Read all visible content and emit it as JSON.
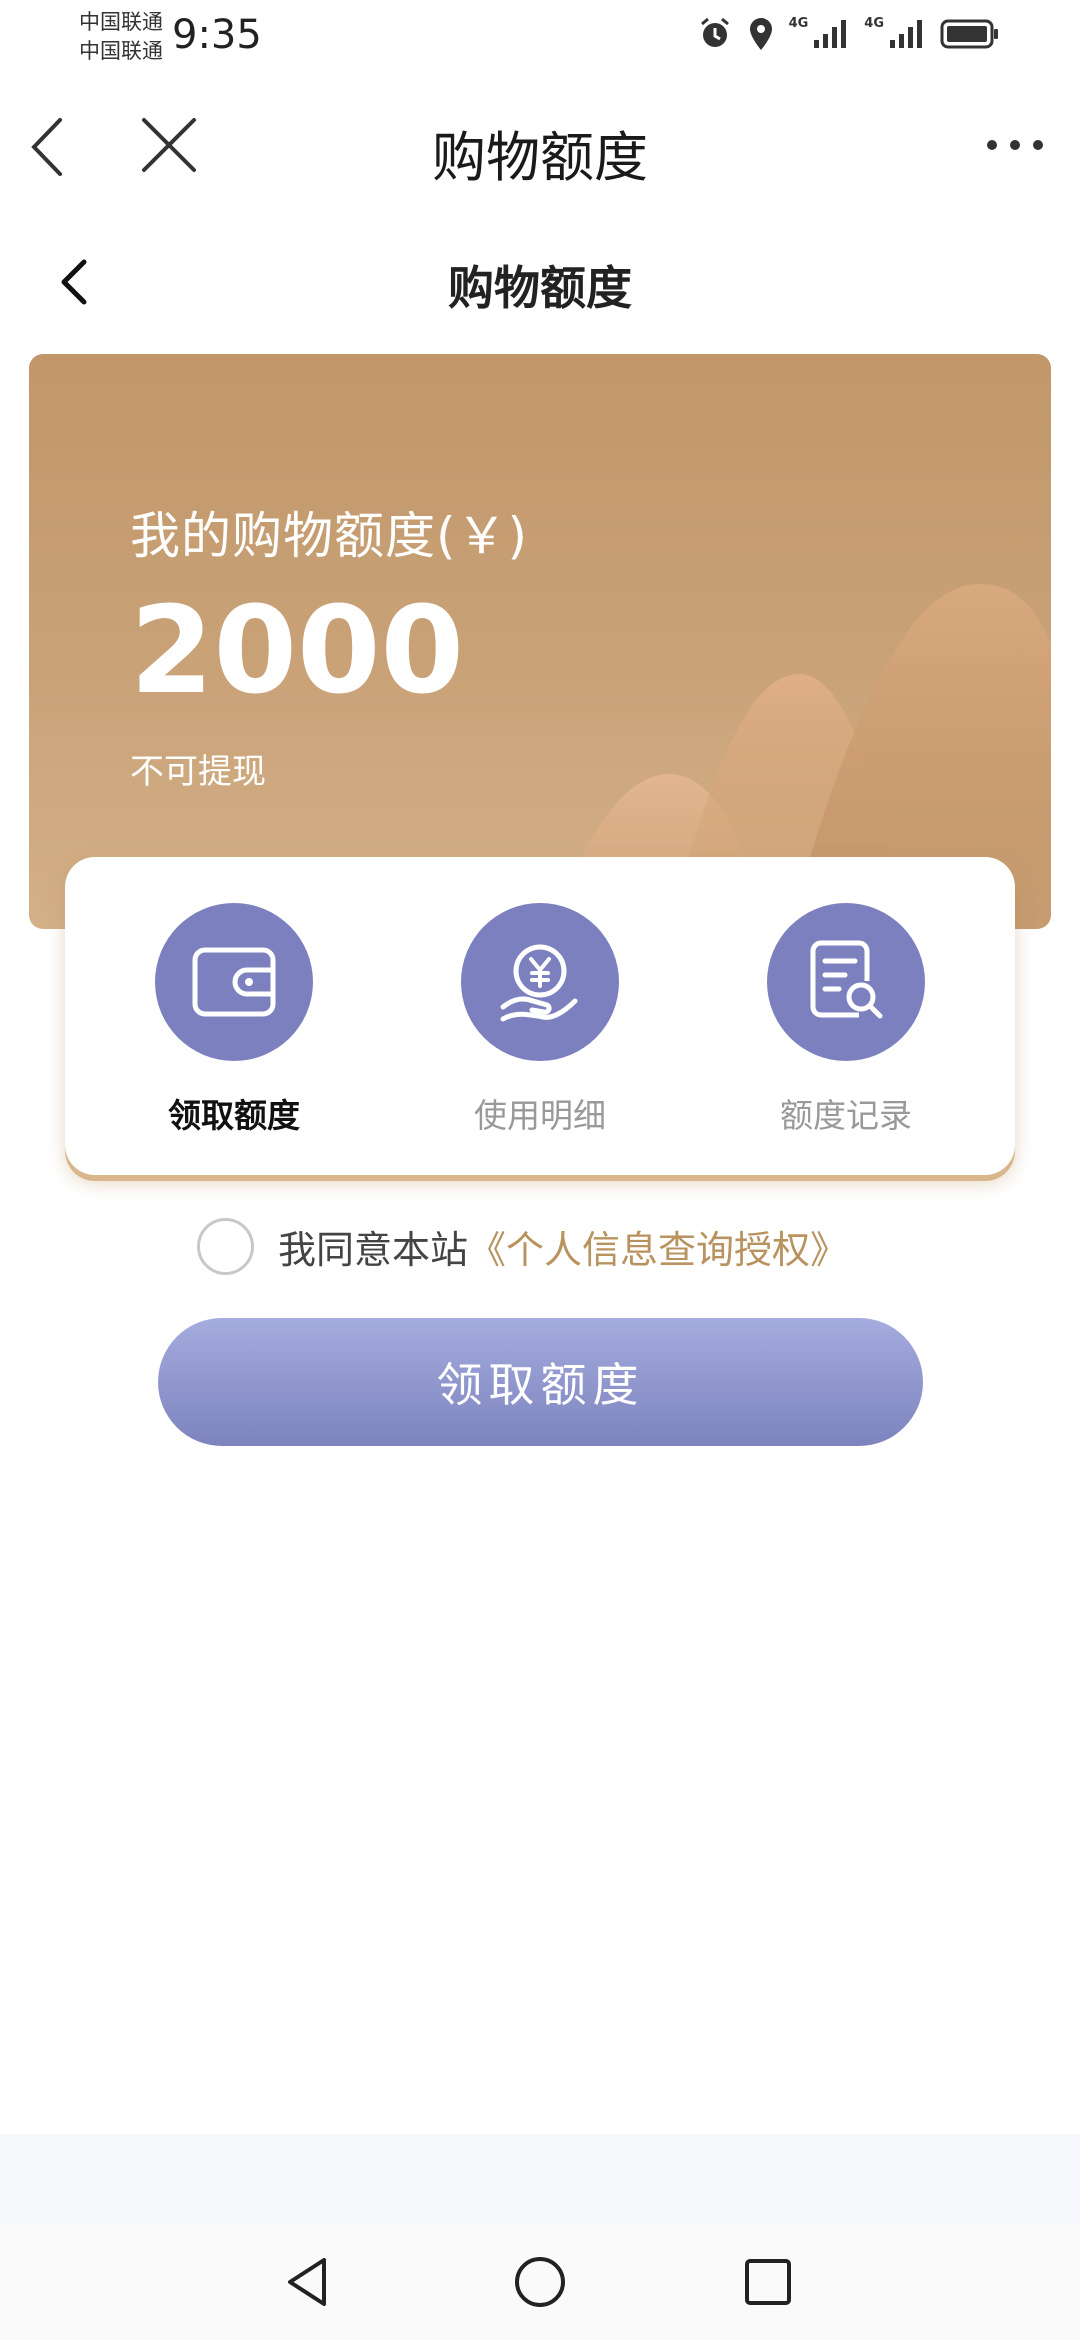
{
  "status_bar": {
    "carrier_1": "中国联通",
    "carrier_2": "中国联通",
    "time": "9:35",
    "network_1": "4G",
    "network_2": "4G"
  },
  "top_nav": {
    "title": "购物额度"
  },
  "page_header": {
    "title": "购物额度"
  },
  "quota_card": {
    "label": "我的购物额度(￥)",
    "amount": "2000",
    "note": "不可提现"
  },
  "actions": [
    {
      "label": "领取额度",
      "icon": "wallet-icon",
      "active": true
    },
    {
      "label": "使用明细",
      "icon": "yuan-hand-icon",
      "active": false
    },
    {
      "label": "额度记录",
      "icon": "document-search-icon",
      "active": false
    }
  ],
  "agreement": {
    "text": "我同意本站",
    "link": "《个人信息查询授权》",
    "checked": false
  },
  "claim_button": {
    "label": "领取额度"
  },
  "colors": {
    "card_gold": "#c1976a",
    "accent_purple": "#7c80be",
    "link_gold": "#b8935f"
  }
}
